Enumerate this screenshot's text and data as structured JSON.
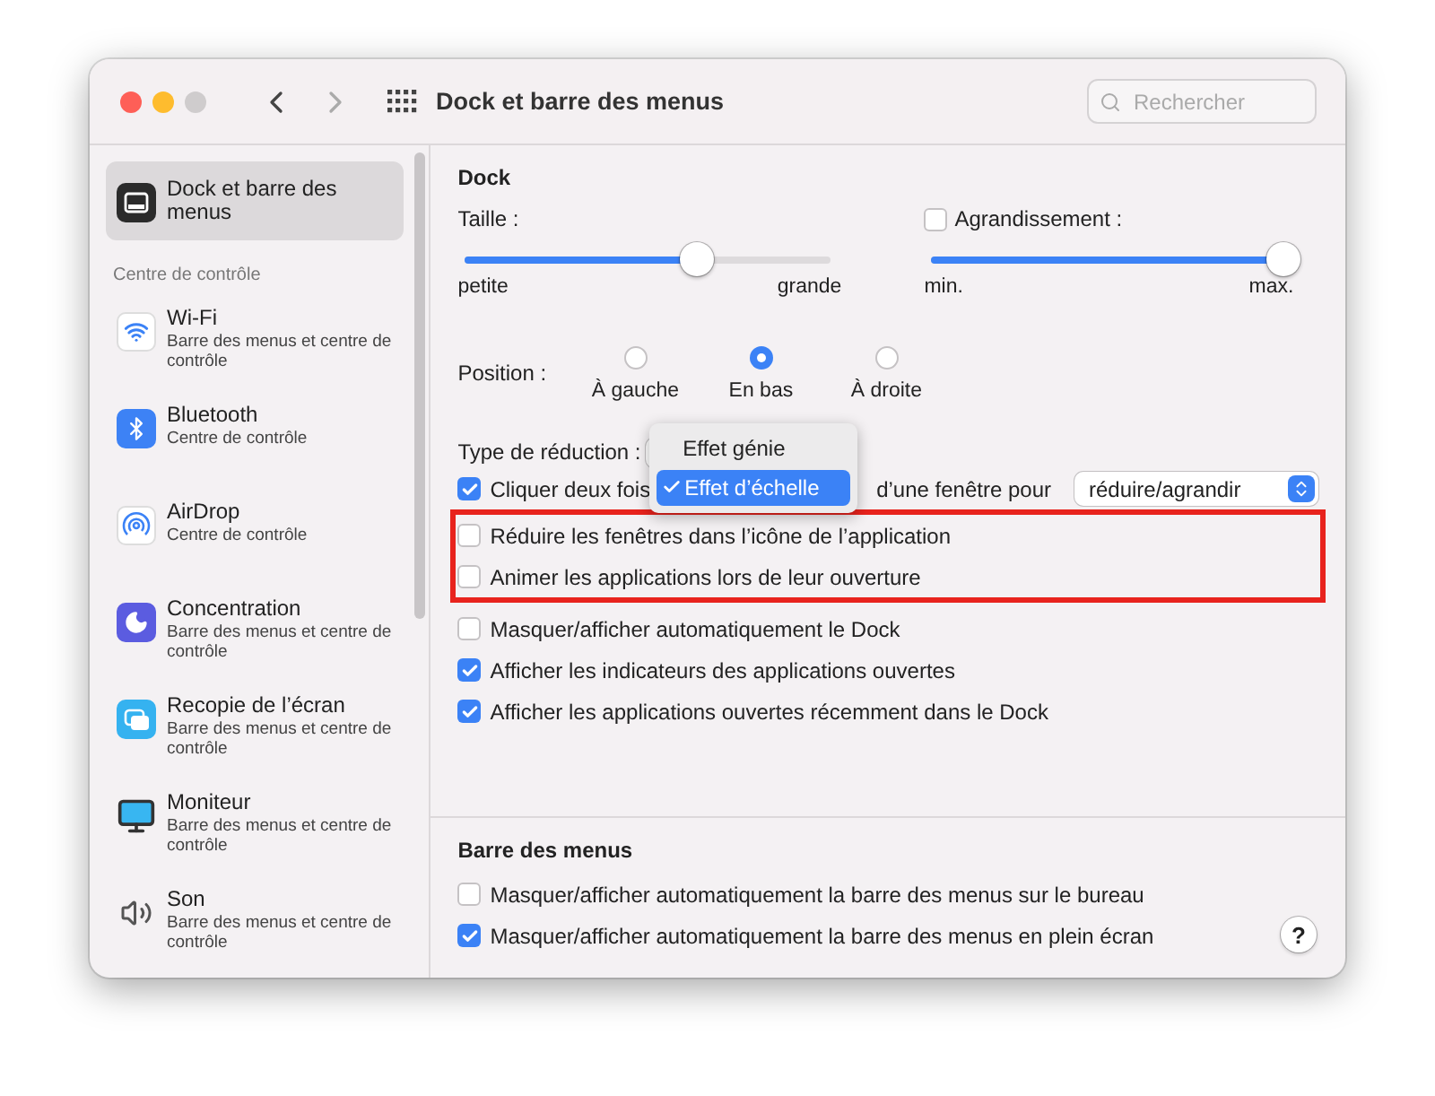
{
  "window": {
    "title": "Dock et barre des menus",
    "search": {
      "placeholder": "Rechercher"
    }
  },
  "sidebar": {
    "items": [
      {
        "kind": "dock",
        "title": "Dock et barre des menus",
        "selected": true
      },
      {
        "kind": "header",
        "title": "Centre de contrôle"
      },
      {
        "kind": "wifi",
        "title": "Wi-Fi",
        "subtitle": "Barre des menus et centre de contrôle",
        "selected": false
      },
      {
        "kind": "bluetooth",
        "title": "Bluetooth",
        "subtitle": "Centre de contrôle",
        "selected": false
      },
      {
        "kind": "airdrop",
        "title": "AirDrop",
        "subtitle": "Centre de contrôle",
        "selected": false
      },
      {
        "kind": "focus",
        "title": "Concentration",
        "subtitle": "Barre des menus et centre de contrôle",
        "selected": false
      },
      {
        "kind": "mirroring",
        "title": "Recopie de l’écran",
        "subtitle": "Barre des menus et centre de contrôle",
        "selected": false
      },
      {
        "kind": "display",
        "title": "Moniteur",
        "subtitle": "Barre des menus et centre de contrôle",
        "selected": false
      },
      {
        "kind": "sound",
        "title": "Son",
        "subtitle": "Barre des menus et centre de contrôle",
        "selected": false
      }
    ]
  },
  "dock": {
    "title": "Dock",
    "size": {
      "label": "Taille :",
      "level": 0.63,
      "min": "petite",
      "max": "grande"
    },
    "magnification": {
      "label": "Agrandissement :",
      "checked": false,
      "level": 1.0,
      "min": "min.",
      "max": "max."
    },
    "position": {
      "label": "Position :",
      "options": [
        {
          "label": "À gauche",
          "selected": false
        },
        {
          "label": "En bas",
          "selected": true
        },
        {
          "label": "À droite",
          "selected": false
        }
      ]
    },
    "minimize": {
      "label": "Type de réduction :",
      "menu": [
        {
          "label": "Effet génie",
          "selected": false
        },
        {
          "label": "Effet d’échelle",
          "selected": true
        }
      ]
    },
    "double_click": {
      "checked": true,
      "label_before": "Cliquer deux fois",
      "label_after": "d’une fenêtre pour",
      "value": "réduire/agrandir"
    },
    "checkboxes": [
      {
        "label": "Réduire les fenêtres dans l’icône de l’application",
        "checked": false,
        "highlighted": true
      },
      {
        "label": "Animer les applications lors de leur ouverture",
        "checked": false,
        "highlighted": true
      },
      {
        "label": "Masquer/afficher automatiquement le Dock",
        "checked": false,
        "highlighted": false
      },
      {
        "label": "Afficher les indicateurs des applications ouvertes",
        "checked": true,
        "highlighted": false
      },
      {
        "label": "Afficher les applications ouvertes récemment dans le Dock",
        "checked": true,
        "highlighted": false
      }
    ]
  },
  "menu_bar": {
    "title": "Barre des menus",
    "checkboxes": [
      {
        "label": "Masquer/afficher automatiquement la barre des menus sur le bureau",
        "checked": false
      },
      {
        "label": "Masquer/afficher automatiquement la barre des menus en plein écran",
        "checked": true
      }
    ],
    "help": "?"
  }
}
